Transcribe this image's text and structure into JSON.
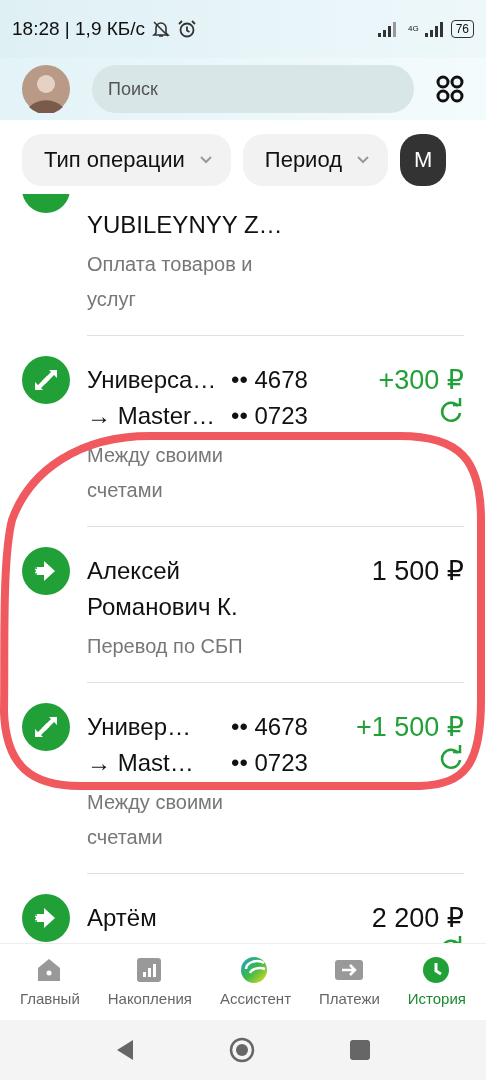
{
  "status_bar": {
    "time": "18:28 | 1,9 КБ/с",
    "network": "4G",
    "battery": "76"
  },
  "header": {
    "search": {
      "placeholder": "Поиск"
    }
  },
  "filters": [
    {
      "label": "Тип операции",
      "dropdown": true,
      "selected": false
    },
    {
      "label": "Период",
      "dropdown": true,
      "selected": false
    },
    {
      "label": "М",
      "dropdown": false,
      "selected": true
    }
  ],
  "transactions": [
    {
      "kind": "purchase",
      "cut": true,
      "title": [
        {
          "name": "YUBILEYNYY Z…"
        }
      ],
      "subtitle": "Оплата товаров и услуг"
    },
    {
      "kind": "exchange",
      "cut": false,
      "title": [
        {
          "name": "Универса…",
          "card": "•• 4678"
        },
        {
          "name": "→ Master…",
          "card": "•• 0723"
        }
      ],
      "amount": "+300 ₽",
      "incoming": true,
      "recurring": true,
      "subtitle": "Между своими счетами"
    },
    {
      "kind": "transfer",
      "cut": false,
      "title": [
        {
          "name": "Алексей Романович К."
        }
      ],
      "amount": "1 500 ₽",
      "incoming": false,
      "recurring": false,
      "subtitle": "Перевод по СБП"
    },
    {
      "kind": "exchange",
      "cut": false,
      "title": [
        {
          "name": "Универ…",
          "card": "•• 4678"
        },
        {
          "name": "→ Mast…",
          "card": "•• 0723"
        }
      ],
      "amount": "+1 500 ₽",
      "incoming": true,
      "recurring": true,
      "subtitle": "Между своими счетами"
    },
    {
      "kind": "transfer",
      "cut": false,
      "title": [
        {
          "name": "Артём"
        }
      ],
      "amount": "2 200 ₽",
      "incoming": false,
      "recurring": true
    }
  ],
  "bottom_nav": [
    {
      "label": "Главный",
      "selected": false
    },
    {
      "label": "Накопления",
      "selected": false
    },
    {
      "label": "Ассистент",
      "selected": false
    },
    {
      "label": "Платежи",
      "selected": false
    },
    {
      "label": "История",
      "selected": true
    }
  ]
}
